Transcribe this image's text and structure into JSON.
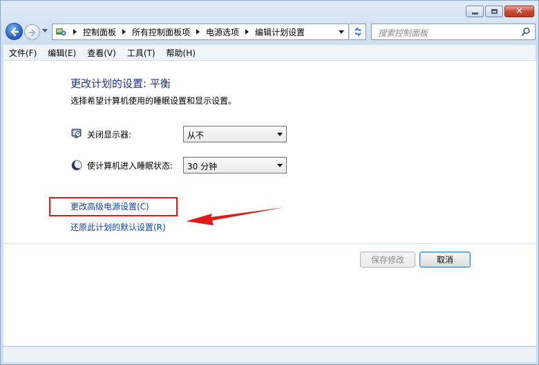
{
  "breadcrumb": [
    "控制面板",
    "所有控制面板项",
    "电源选项",
    "编辑计划设置"
  ],
  "search": {
    "placeholder": "搜索控制面板"
  },
  "menu": [
    "文件(F)",
    "编辑(E)",
    "查看(V)",
    "工具(T)",
    "帮助(H)"
  ],
  "page": {
    "title": "更改计划的设置: 平衡",
    "subtitle": "选择希望计算机使用的睡眠设置和显示设置。"
  },
  "settings": {
    "display_label": "关闭显示器:",
    "display_value": "从不",
    "sleep_label": "使计算机进入睡眠状态:",
    "sleep_value": "30 分钟"
  },
  "links": {
    "advanced": "更改高级电源设置(C)",
    "restore": "还原此计划的默认设置(R)"
  },
  "buttons": {
    "save": "保存修改",
    "cancel": "取消"
  },
  "colors": {
    "annotation": "#e11a1a",
    "link": "#0c46a8",
    "title": "#1e3287"
  }
}
